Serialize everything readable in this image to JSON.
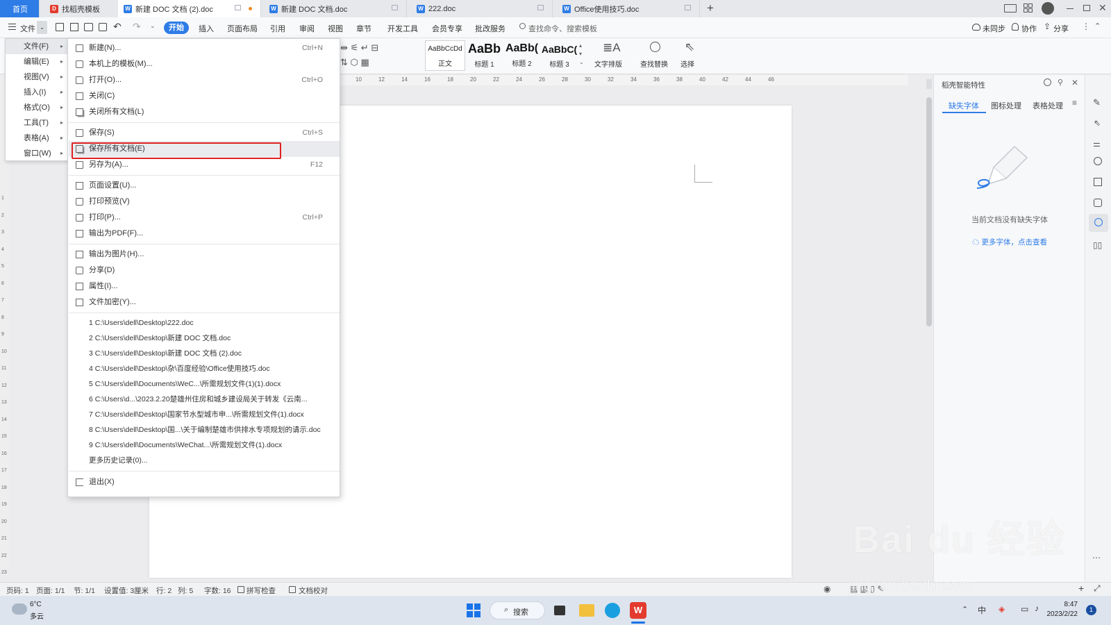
{
  "tabs": [
    {
      "label": "首页",
      "kind": "home"
    },
    {
      "label": "找稻壳模板",
      "kind": "docer"
    },
    {
      "label": "新建 DOC 文档 (2).doc",
      "kind": "doc",
      "active": true
    },
    {
      "label": "新建 DOC 文档.doc",
      "kind": "doc"
    },
    {
      "label": "222.doc",
      "kind": "doc"
    },
    {
      "label": "Office使用技巧.doc",
      "kind": "doc"
    }
  ],
  "new_tab": "+",
  "menu_tabs": {
    "file": "文件",
    "items": [
      "开始",
      "插入",
      "页面布局",
      "引用",
      "审阅",
      "视图",
      "章节",
      "开发工具",
      "会员专享",
      "批改服务"
    ],
    "search_placeholder": "查找命令、搜索模板",
    "unsync": "未同步",
    "collab": "协作",
    "share": "分享"
  },
  "ribbon": {
    "styles": [
      {
        "preview": "AaBbCcDd",
        "name": "正文"
      },
      {
        "preview": "AaBb",
        "name": "标题 1"
      },
      {
        "preview": "AaBb(",
        "name": "标题 2"
      },
      {
        "preview": "AaBbC(",
        "name": "标题 3"
      }
    ],
    "text_layout": "文字排版",
    "find_replace": "查找替换",
    "select": "选择"
  },
  "ruler_ticks": [
    "10",
    "12",
    "14",
    "16",
    "18",
    "20",
    "22",
    "24",
    "26",
    "28",
    "30",
    "32",
    "34",
    "36",
    "38",
    "40",
    "42",
    "44",
    "46"
  ],
  "vruler_ticks": [
    "1",
    "2",
    "3",
    "4",
    "5",
    "6",
    "7",
    "8",
    "9",
    "10",
    "11",
    "12",
    "13",
    "14",
    "15",
    "16",
    "17",
    "18",
    "19",
    "20",
    "21",
    "22",
    "23"
  ],
  "left_menu": [
    {
      "label": "文件(F)"
    },
    {
      "label": "编辑(E)"
    },
    {
      "label": "视图(V)"
    },
    {
      "label": "插入(I)"
    },
    {
      "label": "格式(O)"
    },
    {
      "label": "工具(T)"
    },
    {
      "label": "表格(A)"
    },
    {
      "label": "窗口(W)"
    }
  ],
  "file_menu": {
    "groups": [
      [
        {
          "label": "新建(N)...",
          "shortcut": "Ctrl+N",
          "icon": "new-file-icon"
        },
        {
          "label": "本机上的模板(M)...",
          "shortcut": "",
          "icon": "template-icon"
        },
        {
          "label": "打开(O)...",
          "shortcut": "Ctrl+O",
          "icon": "open-folder-icon"
        },
        {
          "label": "关闭(C)",
          "shortcut": "",
          "icon": "close-doc-icon"
        },
        {
          "label": "关闭所有文档(L)",
          "shortcut": "",
          "icon": "close-all-icon"
        }
      ],
      [
        {
          "label": "保存(S)",
          "shortcut": "Ctrl+S",
          "icon": "save-icon"
        },
        {
          "label": "保存所有文档(E)",
          "shortcut": "",
          "icon": "save-all-icon",
          "highlight": true
        },
        {
          "label": "另存为(A)...",
          "shortcut": "F12",
          "icon": "save-as-icon"
        }
      ],
      [
        {
          "label": "页面设置(U)...",
          "shortcut": "",
          "icon": "page-setup-icon"
        },
        {
          "label": "打印预览(V)",
          "shortcut": "",
          "icon": "print-preview-icon"
        },
        {
          "label": "打印(P)...",
          "shortcut": "Ctrl+P",
          "icon": "print-icon"
        },
        {
          "label": "输出为PDF(F)...",
          "shortcut": "",
          "icon": "pdf-icon"
        }
      ],
      [
        {
          "label": "输出为图片(H)...",
          "shortcut": "",
          "icon": "image-export-icon"
        },
        {
          "label": "分享(D)",
          "shortcut": "",
          "icon": "share-icon"
        },
        {
          "label": "属性(I)...",
          "shortcut": "",
          "icon": "properties-icon"
        },
        {
          "label": "文件加密(Y)...",
          "shortcut": "",
          "icon": "encrypt-icon"
        }
      ]
    ],
    "recent": [
      "1 C:\\Users\\dell\\Desktop\\222.doc",
      "2 C:\\Users\\dell\\Desktop\\新建 DOC 文档.doc",
      "3 C:\\Users\\dell\\Desktop\\新建 DOC 文档 (2).doc",
      "4 C:\\Users\\dell\\Desktop\\杂\\百度经验\\Office使用技巧.doc",
      "5 C:\\Users\\dell\\Documents\\WeC...\\所需规划文件(1)(1).docx",
      "6 C:\\Users\\d...\\2023.2.20楚雄州住房和城乡建设局关于转发《云南...",
      "7 C:\\Users\\dell\\Desktop\\国家节水型城市申...\\所需规划文件(1).docx",
      "8 C:\\Users\\dell\\Desktop\\国...\\关于编制楚雄市供排水专项规划的请示.doc",
      "9 C:\\Users\\dell\\Documents\\WeChat...\\所需规划文件(1).docx"
    ],
    "more_history": "更多历史记录(0)...",
    "exit": "退出(X)"
  },
  "right_panel": {
    "title": "稻壳智能特性",
    "tabs": [
      "缺失字体",
      "图标处理",
      "表格处理"
    ],
    "empty_text": "当前文档没有缺失字体",
    "link": "更多字体，点击查看"
  },
  "status_bar": {
    "items": [
      "页码: 1",
      "页面: 1/1",
      "节: 1/1",
      "设置值: 3厘米",
      "行: 2",
      "列: 5",
      "字数: 16",
      "拼写检查",
      "文档校对"
    ]
  },
  "taskbar": {
    "weather_temp": "6°C",
    "weather_desc": "多云",
    "search": "搜索",
    "time": "8:47",
    "date": "2023/2/22",
    "badge": "1"
  },
  "watermark": {
    "text": "Bai du 经验",
    "url": "jingyan.baidu.com"
  },
  "colors": {
    "accent": "#2e7ce6",
    "highlight_box": "#e02020",
    "tab_active_dot": "#f08a1c",
    "wps_red": "#e33b2e"
  }
}
